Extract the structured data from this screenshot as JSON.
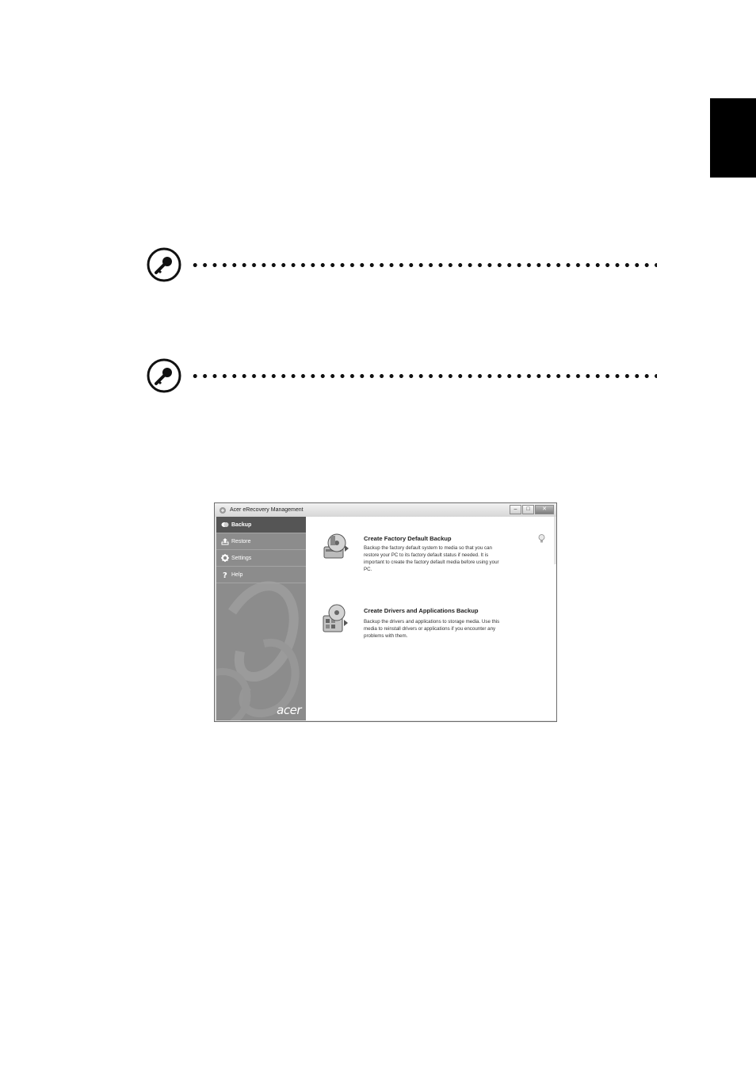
{
  "window": {
    "title": "Acer eRecovery Management",
    "minimize_glyph": "–",
    "maximize_glyph": "□",
    "close_glyph": "✕"
  },
  "sidebar": {
    "items": [
      {
        "label": "Backup",
        "icon": "backup-icon"
      },
      {
        "label": "Restore",
        "icon": "restore-icon"
      },
      {
        "label": "Settings",
        "icon": "gear-icon"
      },
      {
        "label": "Help",
        "icon": "question-icon"
      }
    ],
    "logo": "acer"
  },
  "content": {
    "options": [
      {
        "title": "Create Factory Default Backup",
        "description_lines": [
          "Backup the factory default system to media so that you can",
          "restore your PC to its factory default status if needed. It is",
          "important to create the factory default media before using  your",
          "PC."
        ]
      },
      {
        "title": "Create Drivers and Applications Backup",
        "description_lines": [
          "Backup the drivers and applications to storage media. Use this",
          "media to reinstall drivers or applications if you encounter any",
          "problems with them."
        ]
      }
    ]
  },
  "colors": {
    "sidebar": "#8c8c8c",
    "sidebar_active": "#555555",
    "tab_marker": "#000000"
  }
}
